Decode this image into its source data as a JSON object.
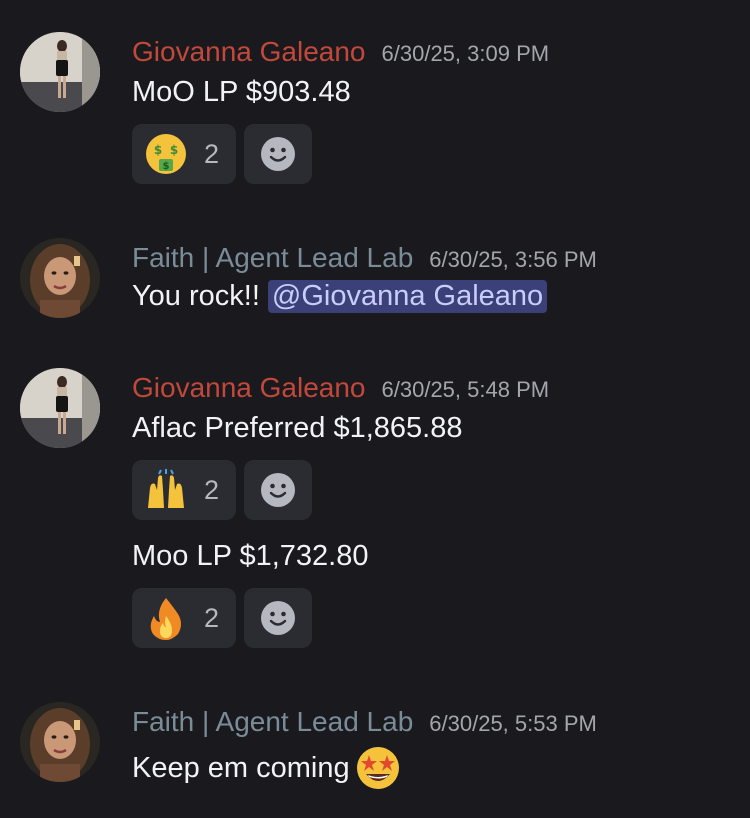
{
  "messages": [
    {
      "author": "Giovanna Galeano",
      "timestamp": "6/30/25, 3:09 PM",
      "text": "MoO LP $903.48",
      "reaction": {
        "emoji": "money-mouth-face",
        "count": "2"
      }
    },
    {
      "author": "Faith | Agent Lead Lab",
      "timestamp": "6/30/25, 3:56 PM",
      "text": "You rock!!",
      "mention": "@Giovanna Galeano"
    },
    {
      "author": "Giovanna Galeano",
      "timestamp": "6/30/25, 5:48 PM",
      "text": "Aflac Preferred $1,865.88",
      "reaction": {
        "emoji": "raising-hands",
        "count": "2"
      },
      "followup": {
        "text": "Moo LP $1,732.80",
        "reaction": {
          "emoji": "fire",
          "count": "2"
        }
      }
    },
    {
      "author": "Faith | Agent Lead Lab",
      "timestamp": "6/30/25, 5:53 PM",
      "text": "Keep em coming",
      "inline_emoji": "star-struck-face"
    }
  ],
  "colors": {
    "background": "#1a1a1e",
    "author_giovanna": "#c1483b",
    "author_faith": "#7a8c98",
    "reaction_bg": "#2b2c31",
    "mention_bg": "#3c4078",
    "mention_text": "#c9cdfb"
  },
  "icons": {
    "add_reaction": "smiley-add-reaction-icon"
  }
}
